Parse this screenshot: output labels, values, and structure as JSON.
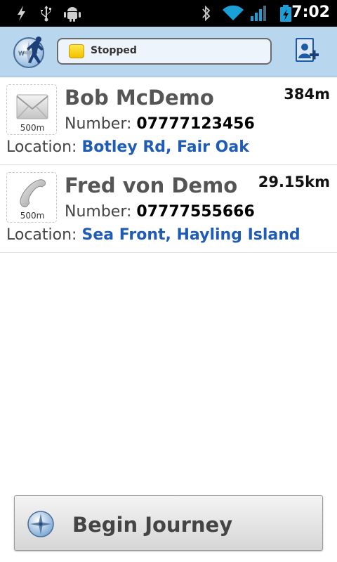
{
  "status_bar": {
    "time": "7:02",
    "icons": [
      "flash-icon",
      "usb-icon",
      "android-debug-icon",
      "bluetooth-icon",
      "wifi-icon",
      "signal-icon",
      "battery-charging-icon"
    ]
  },
  "header": {
    "logo_icon": "compass-runner-logo-icon",
    "status_label": "Stopped",
    "status_color": "#f6d11b",
    "add_contact_icon": "add-contact-icon"
  },
  "contacts": [
    {
      "name": "Bob McDemo",
      "distance": "384m",
      "number_label": "Number:",
      "number": "07777123456",
      "location_label": "Location:",
      "location": "Botley Rd, Fair Oak",
      "alert_icon": "envelope-icon",
      "alert_radius": "500m"
    },
    {
      "name": "Fred von Demo",
      "distance": "29.15km",
      "number_label": "Number:",
      "number": "07777555666",
      "location_label": "Location:",
      "location": "Sea Front, Hayling Island",
      "alert_icon": "phone-handset-icon",
      "alert_radius": "500m"
    }
  ],
  "footer": {
    "begin_label": "Begin Journey",
    "begin_icon": "compass-icon"
  },
  "colors": {
    "header_bg": "#b9d6ef",
    "location_link": "#1f5cb5"
  }
}
